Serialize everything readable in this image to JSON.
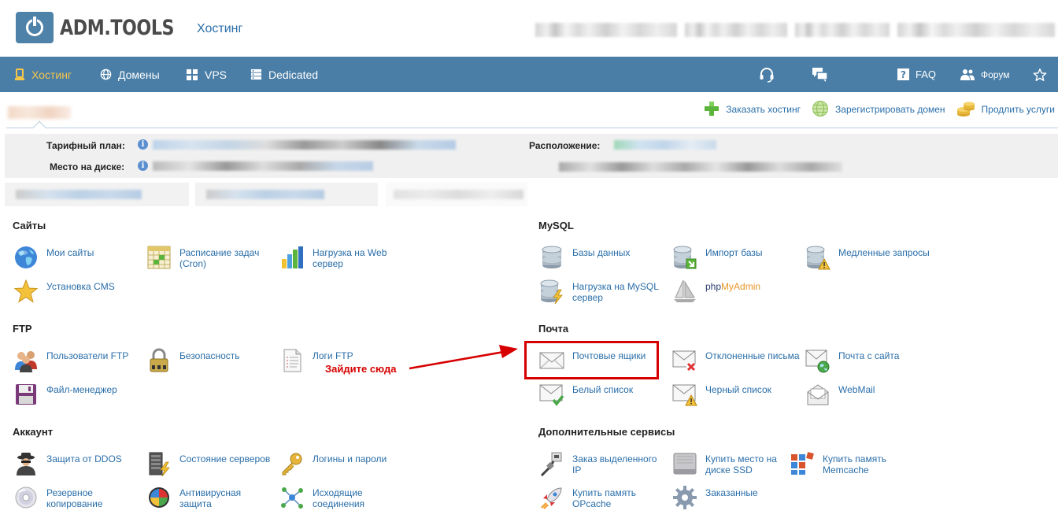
{
  "header": {
    "logo_text": "ADM.TOOLS",
    "top_link": "Хостинг"
  },
  "nav": {
    "items": [
      {
        "label": "Хостинг",
        "icon": "server-icon",
        "active": true
      },
      {
        "label": "Домены",
        "icon": "globe-icon"
      },
      {
        "label": "VPS",
        "icon": "cubes-icon"
      },
      {
        "label": "Dedicated",
        "icon": "rack-icon"
      }
    ],
    "right": {
      "support_icon": "headset-icon",
      "chat_icon": "chat-icon",
      "faq_label": "FAQ",
      "forum_label": "Форум",
      "favorites_icon": "star-icon"
    }
  },
  "actions": {
    "order_hosting": "Заказать хостинг",
    "register_domain": "Зарегистрировать домен",
    "renew_services": "Продлить услуги"
  },
  "info": {
    "plan_label": "Тарифный план:",
    "disk_label": "Место на диске:",
    "location_label": "Расположение:"
  },
  "sections": {
    "sites": {
      "title": "Сайты",
      "items": [
        "Мои сайты",
        "Расписание задач (Cron)",
        "Нагрузка на Web сервер",
        "Установка CMS"
      ]
    },
    "mysql": {
      "title": "MySQL",
      "items": [
        "Базы данных",
        "Импорт базы",
        "Медленные запросы",
        "Нагрузка на MySQL сервер"
      ],
      "pma_php": "php",
      "pma_my": "MyAdmin"
    },
    "ftp": {
      "title": "FTP",
      "items": [
        "Пользователи FTP",
        "Безопасность",
        "Логи FTP",
        "Файл-менеджер"
      ]
    },
    "mail": {
      "title": "Почта",
      "items": [
        "Почтовые ящики",
        "Отклоненные письма",
        "Почта с сайта",
        "Белый список",
        "Черный список",
        "WebMail"
      ]
    },
    "account": {
      "title": "Аккаунт",
      "items": [
        "Защита от DDOS",
        "Состояние серверов",
        "Логины и пароли",
        "Резервное копирование",
        "Антивирусная защита",
        "Исходящие соединения"
      ]
    },
    "extra": {
      "title": "Дополнительные сервисы",
      "items": [
        "Заказ выделенного IP",
        "Купить место на диске SSD",
        "Купить память Memcache",
        "Купить память OPcache",
        "Заказанные"
      ]
    }
  },
  "annotation": {
    "text": "Зайдите сюда",
    "color": "#d60000"
  },
  "colors": {
    "nav_bg": "#4a7ea6",
    "nav_active": "#f7c54a",
    "link": "#2a6ea9"
  }
}
